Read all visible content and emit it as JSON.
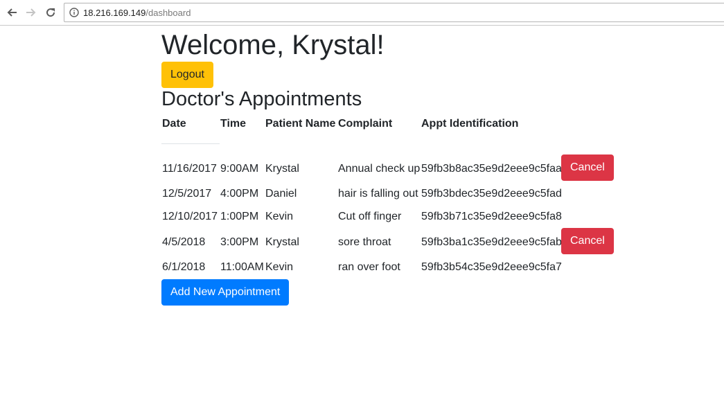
{
  "browser": {
    "url_host": "18.216.169.149",
    "url_path": "/dashboard"
  },
  "page": {
    "welcome": "Welcome, Krystal!",
    "logout_label": "Logout",
    "section_title": "Doctor's Appointments",
    "add_button_label": "Add New Appointment",
    "cancel_label": "Cancel"
  },
  "table": {
    "columns": [
      "Date",
      "Time",
      "Patient Name",
      "Complaint",
      "Appt Identification"
    ],
    "rows": [
      {
        "date": "11/16/2017",
        "time": "9:00AM",
        "patient": "Krystal",
        "complaint": "Annual check up",
        "appt_id": "59fb3b8ac35e9d2eee9c5faa",
        "cancel": true
      },
      {
        "date": "12/5/2017",
        "time": "4:00PM",
        "patient": "Daniel",
        "complaint": "hair is falling out",
        "appt_id": "59fb3bdec35e9d2eee9c5fad",
        "cancel": false
      },
      {
        "date": "12/10/2017",
        "time": "1:00PM",
        "patient": "Kevin",
        "complaint": "Cut off finger",
        "appt_id": "59fb3b71c35e9d2eee9c5fa8",
        "cancel": false
      },
      {
        "date": "4/5/2018",
        "time": "3:00PM",
        "patient": "Krystal",
        "complaint": "sore throat",
        "appt_id": "59fb3ba1c35e9d2eee9c5fab",
        "cancel": true
      },
      {
        "date": "6/1/2018",
        "time": "11:00AM",
        "patient": "Kevin",
        "complaint": "ran over foot",
        "appt_id": "59fb3b54c35e9d2eee9c5fa7",
        "cancel": false
      }
    ]
  },
  "colors": {
    "logout": "#ffc107",
    "cancel": "#dc3545",
    "primary": "#007bff",
    "text": "#212529"
  },
  "icons": {
    "back": "back-arrow-icon",
    "forward": "forward-arrow-icon",
    "reload": "reload-icon",
    "info": "info-icon"
  }
}
